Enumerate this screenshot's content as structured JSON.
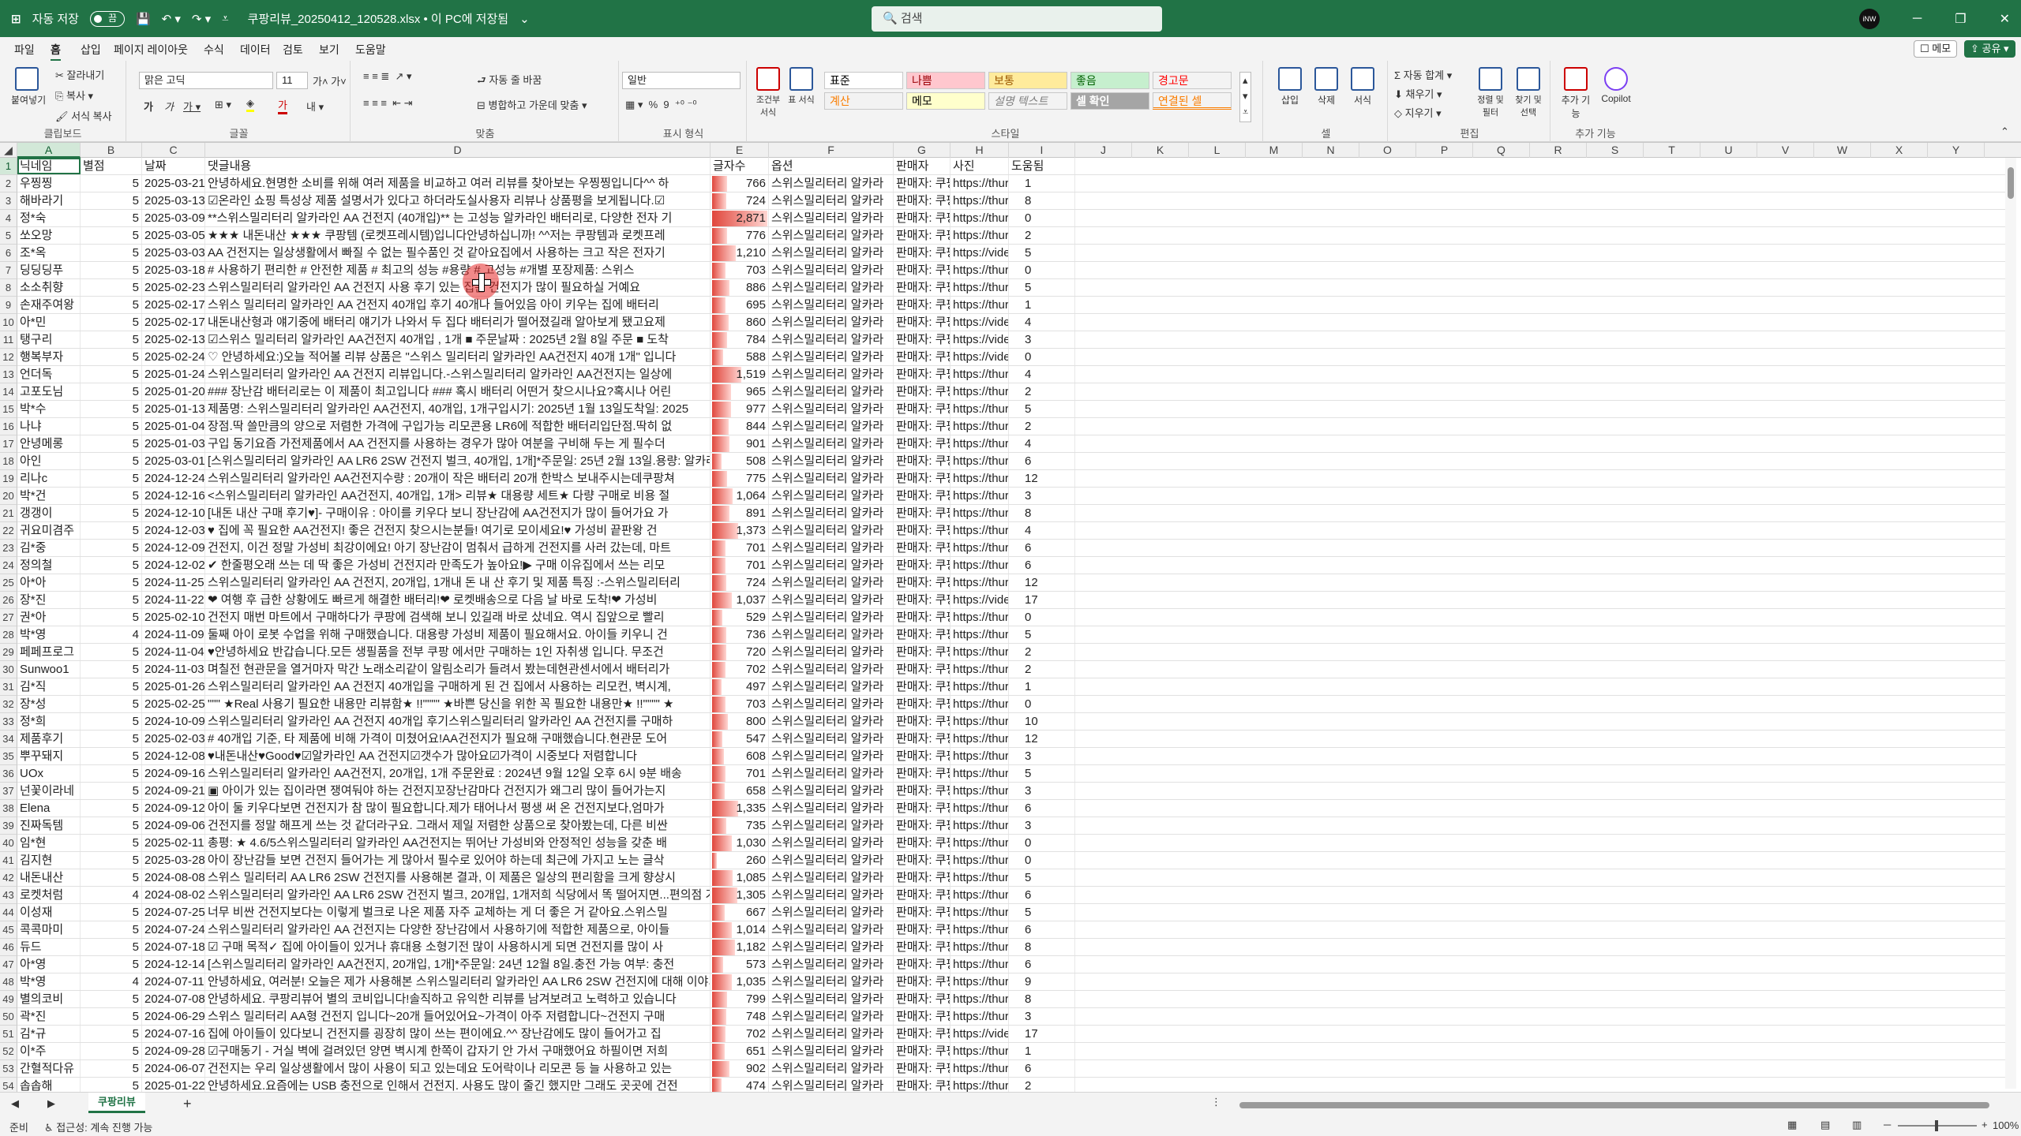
{
  "title": {
    "autosave": "자동 저장",
    "toggle": "끔",
    "filename": "쿠팡리뷰_20250412_120528.xlsx • 이 PC에 저장됨",
    "search": "검색",
    "min": "─",
    "max": "❐",
    "close": "✕"
  },
  "menu": {
    "tabs": [
      "파일",
      "홈",
      "삽입",
      "페이지 레이아웃",
      "수식",
      "데이터",
      "검토",
      "보기",
      "도움말"
    ],
    "active": "홈",
    "memo": "메모",
    "share": "공유"
  },
  "ribbon": {
    "clipboard": {
      "paste": "붙여넣기",
      "cut": "잘라내기",
      "copy": "복사",
      "format_painter": "서식 복사",
      "label": "클립보드"
    },
    "font": {
      "name": "맑은 고딕",
      "size": "11",
      "label": "글꼴"
    },
    "align": {
      "wrap": "자동 줄 바꿈",
      "merge": "병합하고 가운데 맞춤",
      "label": "맞춤"
    },
    "number": {
      "format": "일반",
      "label": "표시 형식"
    },
    "styles": {
      "cond": "조건부 서식",
      "table": "표 서식",
      "cells": [
        {
          "t": "표준",
          "bg": "#ffffff",
          "fg": "#000000"
        },
        {
          "t": "나쁨",
          "bg": "#ffc7ce",
          "fg": "#9c0006"
        },
        {
          "t": "보통",
          "bg": "#ffeb9c",
          "fg": "#9c5700"
        },
        {
          "t": "좋음",
          "bg": "#c6efce",
          "fg": "#006100"
        },
        {
          "t": "경고문",
          "bg": "#f3f3f3",
          "fg": "#ff0000"
        },
        {
          "t": "계산",
          "bg": "#f2f2f2",
          "fg": "#fa7d00"
        },
        {
          "t": "메모",
          "bg": "#ffffcc",
          "fg": "#000000"
        },
        {
          "t": "설명 텍스트",
          "bg": "#f3f3f3",
          "fg": "#7f7f7f"
        },
        {
          "t": "셀 확인",
          "bg": "#a5a5a5",
          "fg": "#ffffff"
        },
        {
          "t": "연결된 셀",
          "bg": "#f3f3f3",
          "fg": "#fa7d00"
        }
      ],
      "label": "스타일"
    },
    "cells": {
      "insert": "삽입",
      "delete": "삭제",
      "format": "서식",
      "label": "셀"
    },
    "editing": {
      "autosum": "자동 합계",
      "fill": "채우기",
      "clear": "지우기",
      "sort": "정렬 및 필터",
      "find": "찾기 및 선택",
      "label": "편집"
    },
    "addins": {
      "addins": "추가 기능",
      "copilot": "Copilot",
      "label": "추가 기능"
    }
  },
  "columns": [
    "A",
    "B",
    "C",
    "D",
    "E",
    "F",
    "G",
    "H",
    "I",
    "J",
    "K",
    "L",
    "M",
    "N",
    "O",
    "P",
    "Q",
    "R",
    "S",
    "T",
    "U",
    "V",
    "W",
    "X",
    "Y"
  ],
  "headers": [
    "닉네임",
    "별점",
    "날짜",
    "댓글내용",
    "글자수",
    "옵션",
    "판매자",
    "사진",
    "도움됨"
  ],
  "rows": [
    [
      "우찡찡",
      "5",
      "2025-03-21",
      "안녕하세요.현명한 소비를 위해 여러 제품을 비교하고 여러 리뷰를 찾아보는 우찡찡입니다^^ 하",
      "766",
      "스위스밀리터리 알카라",
      "판매자: 쿠팡",
      "https://thur",
      "1"
    ],
    [
      "해바라기",
      "5",
      "2025-03-13",
      "☑온라인 쇼핑 특성상 제품 설명서가 있다고 하더라도실사용자 리뷰나 상품평을 보게됩니다.☑",
      "724",
      "스위스밀리터리 알카라",
      "판매자: 쿠팡",
      "https://thur",
      "8"
    ],
    [
      "정*숙",
      "5",
      "2025-03-09",
      "**스위스밀리터리 알카라인 AA 건전지 (40개입)** 는 고성능 알카라인 배터리로, 다양한 전자 기",
      "2,871",
      "스위스밀리터리 알카라",
      "판매자: 쿠팡",
      "https://thur",
      "0"
    ],
    [
      "쏘오망",
      "5",
      "2025-03-05",
      "★★★ 내돈내산 ★★★ 쿠팡템 (로켓프레시템)입니다안녕하십니까! ^^저는 쿠팡템과 로켓프레",
      "776",
      "스위스밀리터리 알카라",
      "판매자: 쿠팡",
      "https://thur",
      "2"
    ],
    [
      "조*옥",
      "5",
      "2025-03-03",
      "AA 건전지는 일상생활에서 빠질 수 없는 필수품인 것 같아요집에서 사용하는 크고 작은 전자기",
      "1,210",
      "스위스밀리터리 알카라",
      "판매자: 쿠팡",
      "https://vide",
      "5"
    ],
    [
      "딩딩딩푸",
      "5",
      "2025-03-18",
      "# 사용하기 편리한 # 안전한 제품 # 최고의 성능 #용량 # 고성능 #개별 포장제품: 스위스",
      "703",
      "스위스밀리터리 알카라",
      "판매자: 쿠팡",
      "https://thur",
      "0"
    ],
    [
      "소소취향",
      "5",
      "2025-02-23",
      "스위스밀리터리 알카라인 AA 건전지 사용 후기 있는 집은 건전지가 많이 필요하실 거예요",
      "886",
      "스위스밀리터리 알카라",
      "판매자: 쿠팡",
      "https://thur",
      "5"
    ],
    [
      "손재주여왕",
      "5",
      "2025-02-17",
      "스위스 밀리터리 알카라인 AA 건전지 40개입 후기 40개나 들어있음 아이 키우는 집에 배터리",
      "695",
      "스위스밀리터리 알카라",
      "판매자: 쿠팡",
      "https://thur",
      "1"
    ],
    [
      "아*민",
      "5",
      "2025-02-17",
      "내돈내산형과 얘기중에 배터리 얘기가 나와서 두 집다 배터리가 떨어졌길래 알아보게 됐고요제",
      "860",
      "스위스밀리터리 알카라",
      "판매자: 쿠팡",
      "https://vide",
      "4"
    ],
    [
      "탱구리",
      "5",
      "2025-02-13",
      "☑스위스 밀리터리 알카라인 AA건전지 40개입 , 1개 ■ 주문날짜 : 2025년 2월 8일 주문 ■ 도착",
      "784",
      "스위스밀리터리 알카라",
      "판매자: 쿠팡",
      "https://vide",
      "3"
    ],
    [
      "행복부자",
      "5",
      "2025-02-24",
      "♡ 안녕하세요:)오늘 적어볼 리뷰 상품은 \"스위스 밀리터리 알카라인 AA건전지 40개 1개\" 입니다",
      "588",
      "스위스밀리터리 알카라",
      "판매자: 쿠팡",
      "https://vide",
      "0"
    ],
    [
      "언더독",
      "5",
      "2025-01-24",
      "스위스밀리터리 알카라인 AA 건전지 리뷰입니다.-스위스밀리터리 알카라인 AA건전지는 일상에",
      "1,519",
      "스위스밀리터리 알카라",
      "판매자: 쿠팡",
      "https://thur",
      "4"
    ],
    [
      "고포도님",
      "5",
      "2025-01-20",
      "### 장난감 배터리로는 이 제품이 최고입니다 ### 혹시 배터리 어떤거 찾으시나요?혹시나 어린",
      "965",
      "스위스밀리터리 알카라",
      "판매자: 쿠팡",
      "https://thur",
      "2"
    ],
    [
      "박*수",
      "5",
      "2025-01-13",
      "제품명: 스위스밀리터리 알카라인 AA건전지, 40개입, 1개구입시기: 2025년 1월 13일도착일: 2025",
      "977",
      "스위스밀리터리 알카라",
      "판매자: 쿠팡",
      "https://thur",
      "5"
    ],
    [
      "나냐",
      "5",
      "2025-01-04",
      "장점.딱 쓸만큼의 양으로 저렴한 가격에 구입가능 리모콘용 LR6에 적합한 배터리입단점.딱히 없",
      "844",
      "스위스밀리터리 알카라",
      "판매자: 쿠팡",
      "https://thur",
      "2"
    ],
    [
      "안녕메롱",
      "5",
      "2025-01-03",
      "구입 동기요즘 가전제품에서 AA 건전지를 사용하는 경우가 많아 여분을 구비해 두는 게 필수더",
      "901",
      "스위스밀리터리 알카라",
      "판매자: 쿠팡",
      "https://thur",
      "4"
    ],
    [
      "아인",
      "5",
      "2025-03-01",
      "[스위스밀리터리 알카라인 AA LR6 2SW 건전지 벌크, 40개입, 1개]*주문일: 25년 2월 13일.용량: 알카라인 AA",
      "508",
      "스위스밀리터리 알카라",
      "판매자: 쿠팡",
      "https://thur",
      "6"
    ],
    [
      "리나c",
      "5",
      "2024-12-24",
      "스위스밀리터리 알카라인 AA건전지수량 : 20개이 작은 배터리 20개 한박스 보내주시는데쿠팡쳐",
      "775",
      "스위스밀리터리 알카라",
      "판매자: 쿠팡",
      "https://thur",
      "12"
    ],
    [
      "박*건",
      "5",
      "2024-12-16",
      "<스위스밀리터리 알카라인 AA건전지, 40개입, 1개> 리뷰★ 대용량 세트★ 다량 구매로 비용 절",
      "1,064",
      "스위스밀리터리 알카라",
      "판매자: 쿠팡",
      "https://thur",
      "3"
    ],
    [
      "갱갱이",
      "5",
      "2024-12-10",
      "[내돈 내산 구매 후기♥]- 구매이유 : 아이를 키우다 보니 장난감에 AA건전지가 많이 들어가요 가",
      "891",
      "스위스밀리터리 알카라",
      "판매자: 쿠팡",
      "https://thur",
      "8"
    ],
    [
      "귀요미겸주",
      "5",
      "2024-12-03",
      "♥ 집에 꼭 필요한 AA건전지! 좋은 건전지 찾으시는분들! 여기로 모이세요!♥ 가성비 끝판왕 건",
      "1,373",
      "스위스밀리터리 알카라",
      "판매자: 쿠팡",
      "https://thur",
      "4"
    ],
    [
      "김*중",
      "5",
      "2024-12-09",
      "건전지, 이건 정말 가성비 최강이에요! 아기 장난감이 멈춰서 급하게 건전지를 사러 갔는데, 마트",
      "701",
      "스위스밀리터리 알카라",
      "판매자: 쿠팡",
      "https://thur",
      "6"
    ],
    [
      "정의철",
      "5",
      "2024-12-02",
      "✔ 한줄평오래 쓰는 데 딱 좋은 가성비 건전지라 만족도가 높아요!▶ 구매 이유집에서 쓰는 리모",
      "701",
      "스위스밀리터리 알카라",
      "판매자: 쿠팡",
      "https://thur",
      "6"
    ],
    [
      "아*아",
      "5",
      "2024-11-25",
      "스위스밀리터리 알카라인 AA 건전지, 20개입, 1개내 돈 내 산 후기 및 제품 특징 :-스위스밀리터리",
      "724",
      "스위스밀리터리 알카라",
      "판매자: 쿠팡",
      "https://thur",
      "12"
    ],
    [
      "장*진",
      "5",
      "2024-11-22",
      "❤ 여행 후 급한 상황에도 빠르게 해결한 배터리!❤ 로켓배송으로 다음 날 바로 도착!❤ 가성비",
      "1,037",
      "스위스밀리터리 알카라",
      "판매자: 쿠팡",
      "https://vide",
      "17"
    ],
    [
      "권*아",
      "5",
      "2025-02-10",
      "건전지 매번 마트에서 구매하다가 쿠팡에 검색해 보니 있길래 바로 샀네요. 역시 집앞으로 빨리",
      "529",
      "스위스밀리터리 알카라",
      "판매자: 쿠팡",
      "https://thur",
      "0"
    ],
    [
      "박*영",
      "4",
      "2024-11-09",
      "둘째 아이 로봇 수업을 위해 구매했습니다. 대용량 가성비 제품이 필요해서요. 아이들 키우니 건",
      "736",
      "스위스밀리터리 알카라",
      "판매자: 쿠팡",
      "https://thur",
      "5"
    ],
    [
      "페페프로그",
      "5",
      "2024-11-04",
      "♥안녕하세요 반갑습니다.모든 생필품을 전부 쿠팡 에서만 구매하는 1인 자취생 입니다. 무조건",
      "720",
      "스위스밀리터리 알카라",
      "판매자: 쿠팡",
      "https://thur",
      "2"
    ],
    [
      "Sunwoo1",
      "5",
      "2024-11-03",
      "며칠전 현관문을 열거마자 막간 노래소리같이 알림소리가 들려서 봤는데현관센서에서 배터리가",
      "702",
      "스위스밀리터리 알카라",
      "판매자: 쿠팡",
      "https://thur",
      "2"
    ],
    [
      "김*직",
      "5",
      "2025-01-26",
      "스위스밀리터리 알카라인 AA 건전지 40개입을 구매하게 된 건 집에서 사용하는 리모컨, 벽시계,",
      "497",
      "스위스밀리터리 알카라",
      "판매자: 쿠팡",
      "https://thur",
      "1"
    ],
    [
      "장*성",
      "5",
      "2025-02-25",
      "\"\"\" ★Real 사용기 필요한 내용만 리뷰함★ !!\"\"\"\" ★바쁜 당신을 위한 꼭 필요한 내용만★ !!\"\"\"\" ★",
      "703",
      "스위스밀리터리 알카라",
      "판매자: 쿠팡",
      "https://thur",
      "0"
    ],
    [
      "정*희",
      "5",
      "2024-10-09",
      "스위스밀리터리 알카라인 AA 건전지 40개입 후기스위스밀리터리 알카라인 AA 건전지를 구매하",
      "800",
      "스위스밀리터리 알카라",
      "판매자: 쿠팡",
      "https://thur",
      "10"
    ],
    [
      "제품후기",
      "5",
      "2025-02-03",
      "# 40개입 기준, 타 제품에 비해 가격이 미쳤어요!AA건전지가 필요해 구매했습니다.현관문 도어",
      "547",
      "스위스밀리터리 알카라",
      "판매자: 쿠팡",
      "https://thur",
      "12"
    ],
    [
      "뿌꾸돼지",
      "5",
      "2024-12-08",
      "♥내돈내산♥Good♥☑알카라인 AA 건전지☑갯수가 많아요☑가격이 시중보다 저렴합니다",
      "608",
      "스위스밀리터리 알카라",
      "판매자: 쿠팡",
      "https://thur",
      "3"
    ],
    [
      "UOx",
      "5",
      "2024-09-16",
      "스위스밀리터리 알카라인 AA건전지, 20개입, 1개 주문완료 : 2024년 9월 12일 오후 6시 9분 배송",
      "701",
      "스위스밀리터리 알카라",
      "판매자: 쿠팡",
      "https://thur",
      "5"
    ],
    [
      "넌꽃이라네",
      "5",
      "2024-09-21",
      "▣ 아이가 있는 집이라면 쟁여둬야 하는 건전지꼬장난감마다 건전지가 왜그리 많이 들어가는지",
      "658",
      "스위스밀리터리 알카라",
      "판매자: 쿠팡",
      "https://thur",
      "3"
    ],
    [
      "Elena",
      "5",
      "2024-09-12",
      "아이 둘 키우다보면 건전지가 참 많이 필요합니다.제가 태어나서 평생 써 온 건전지보다,엄마가",
      "1,335",
      "스위스밀리터리 알카라",
      "판매자: 쿠팡",
      "https://thur",
      "6"
    ],
    [
      "진짜독템",
      "5",
      "2024-09-06",
      "건전지를 정말 해프게 쓰는 것 같더라구요. 그래서 제일 저렴한 상품으로 찾아봤는데, 다른 비싼",
      "735",
      "스위스밀리터리 알카라",
      "판매자: 쿠팡",
      "https://thur",
      "3"
    ],
    [
      "임*현",
      "5",
      "2025-02-11",
      "총평: ★ 4.6/5스위스밀리터리 알카라인 AA건전지는 뛰어난 가성비와 안정적인 성능을 갖춘 배",
      "1,030",
      "스위스밀리터리 알카라",
      "판매자: 쿠팡",
      "https://thur",
      "0"
    ],
    [
      "김지현",
      "5",
      "2025-03-28",
      "아이 장난감들 보면 건전지 들어가는 게 많아서 필수로 있어야 하는데 최근에 가지고 노는 글삭",
      "260",
      "스위스밀리터리 알카라",
      "판매자: 쿠팡",
      "https://thur",
      "0"
    ],
    [
      "내돈내산",
      "5",
      "2024-08-08",
      "스위스 밀리터리 AA LR6 2SW 건전지를 사용해본 결과, 이 제품은 일상의 편리함을 크게 향상시",
      "1,085",
      "스위스밀리터리 알카라",
      "판매자: 쿠팡",
      "https://thur",
      "5"
    ],
    [
      "로켓처럼",
      "4",
      "2024-08-02",
      "스위스밀리터리 알카라인 AA LR6 2SW 건전지 벌크, 20개입, 1개저희 식당에서 똑 떨어지면...편의점 가서",
      "1,305",
      "스위스밀리터리 알카라",
      "판매자: 쿠팡",
      "https://thur",
      "6"
    ],
    [
      "이성재",
      "5",
      "2024-07-25",
      "너무 비싼 건전지보다는 이렇게 벌크로 나온 제품 자주 교체하는 게 더 좋은 거 같아요.스위스밀",
      "667",
      "스위스밀리터리 알카라",
      "판매자: 쿠팡",
      "https://thur",
      "5"
    ],
    [
      "콕콕마미",
      "5",
      "2024-07-24",
      "스위스밀리터리 알카라인 AA 건전지는 다양한 장난감에서 사용하기에 적합한 제품으로, 아이들",
      "1,014",
      "스위스밀리터리 알카라",
      "판매자: 쿠팡",
      "https://thur",
      "6"
    ],
    [
      "듀드",
      "5",
      "2024-07-18",
      "☑ 구매 목적✓ 집에 아이들이 있거나 휴대용 소형기전 많이 사용하시게 되면 건전지를 많이 사",
      "1,182",
      "스위스밀리터리 알카라",
      "판매자: 쿠팡",
      "https://thur",
      "8"
    ],
    [
      "아*영",
      "5",
      "2024-12-14",
      "[스위스밀리터리 알카라인 AA건전지, 20개입, 1개]*주문일: 24년 12월 8일.충전 가능 여부: 충전",
      "573",
      "스위스밀리터리 알카라",
      "판매자: 쿠팡",
      "https://thur",
      "6"
    ],
    [
      "박*영",
      "4",
      "2024-07-11",
      "안녕하세요, 여러분! 오늘은 제가 사용해본 스위스밀리터리 알카라인 AA LR6 2SW 건전지에 대해 이야기",
      "1,035",
      "스위스밀리터리 알카라",
      "판매자: 쿠팡",
      "https://thur",
      "9"
    ],
    [
      "별의코비",
      "5",
      "2024-07-08",
      "안녕하세요. 쿠팡리뷰어 별의 코비입니다!솔직하고 유익한 리뷰를 남겨보려고 노력하고 있습니다",
      "799",
      "스위스밀리터리 알카라",
      "판매자: 쿠팡",
      "https://thur",
      "8"
    ],
    [
      "곽*진",
      "5",
      "2024-06-29",
      "스위스 밀리터리 AA형 건전지 입니다~20개 들어있어요~가격이 아주 저렴합니다~건전지 구매",
      "748",
      "스위스밀리터리 알카라",
      "판매자: 쿠팡",
      "https://thur",
      "3"
    ],
    [
      "김*규",
      "5",
      "2024-07-16",
      "집에 아이들이 있다보니 건전지를 굉장히 많이 쓰는 편이에요.^^ 장난감에도 많이 들어가고 집",
      "702",
      "스위스밀리터리 알카라",
      "판매자: 쿠팡",
      "https://vide",
      "17"
    ],
    [
      "이*주",
      "5",
      "2024-09-28",
      "☑구매동기 - 거실 벽에 걸려있던 양면 벽시계 한쪽이 갑자기 안 가서 구매했어요 하필이면 저희",
      "651",
      "스위스밀리터리 알카라",
      "판매자: 쿠팡",
      "https://thur",
      "1"
    ],
    [
      "간혈적다유",
      "5",
      "2024-06-07",
      "건전지는 우리 일상생활에서 많이 사용이 되고 있는데요 도어락이나 리모콘 등 늘 사용하고 있는",
      "902",
      "스위스밀리터리 알카라",
      "판매자: 쿠팡",
      "https://thur",
      "6"
    ],
    [
      "솝솝해",
      "5",
      "2025-01-22",
      "안녕하세요.요즘에는 USB 충전으로 인해서 건전지. 사용도 많이 줄긴 했지만 그래도 곳곳에 건전",
      "474",
      "스위스밀리터리 알카라",
      "판매자: 쿠팡",
      "https://thur",
      "2"
    ]
  ],
  "sheet": {
    "tab": "쿠팡리뷰",
    "add": "+"
  },
  "status": {
    "ready": "준비",
    "access": "접근성: 계속 진행 가능",
    "zoom": "100%"
  }
}
